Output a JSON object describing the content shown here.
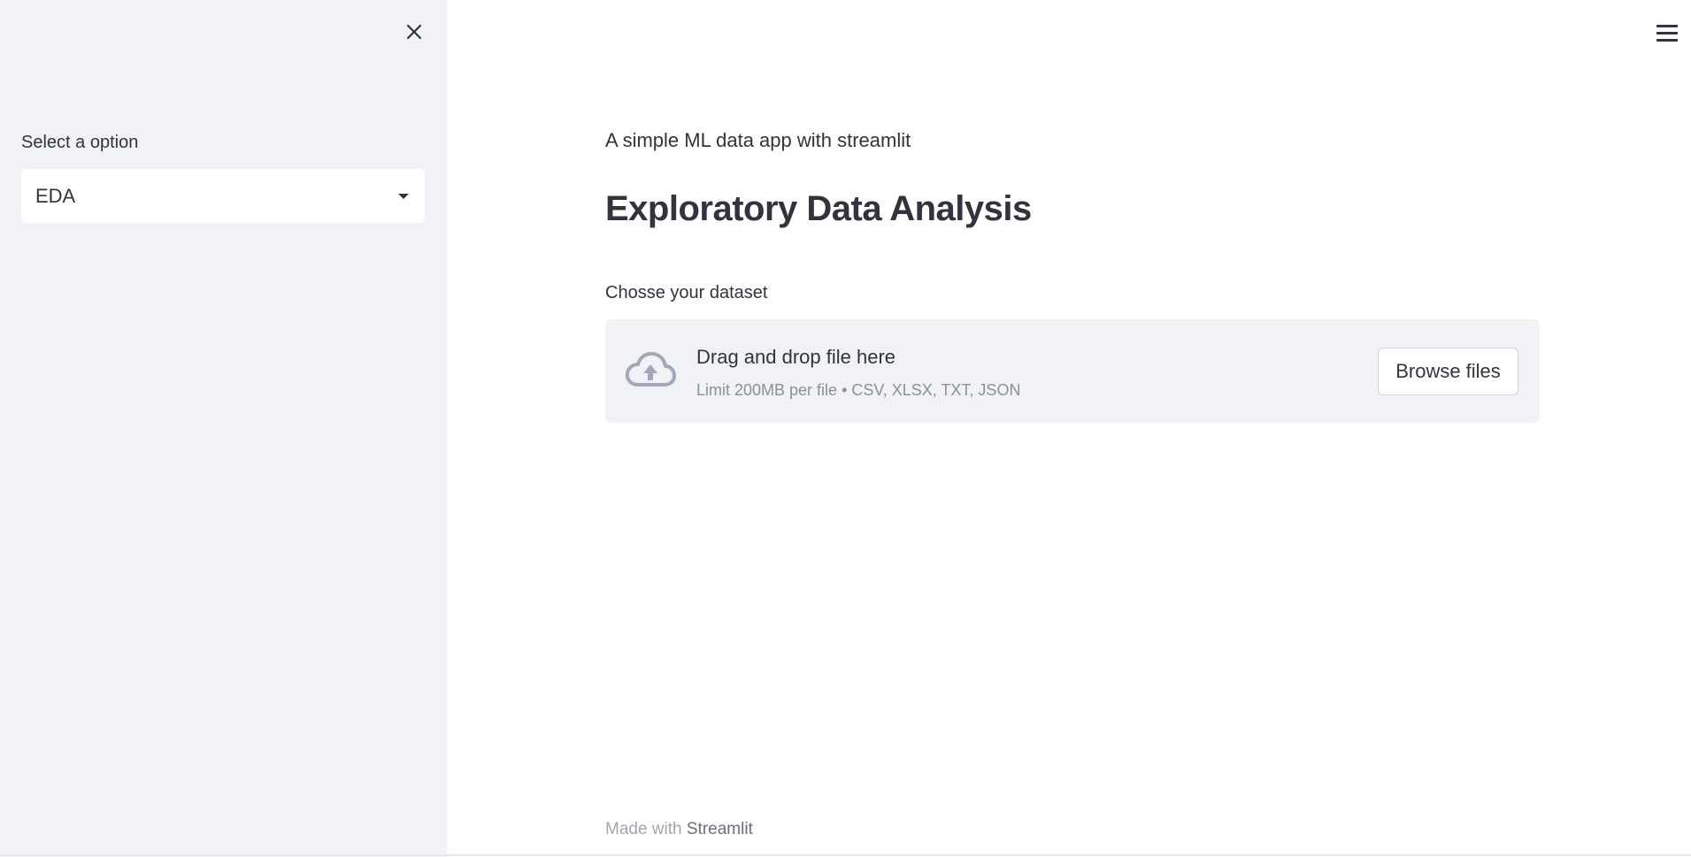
{
  "sidebar": {
    "select_label": "Select a option",
    "select_value": "EDA"
  },
  "main": {
    "subtitle": "A simple ML data app with streamlit",
    "title": "Exploratory Data Analysis",
    "uploader": {
      "label": "Chosse your dataset",
      "drop_text": "Drag and drop file here",
      "limit_text": "Limit 200MB per file • CSV, XLSX, TXT, JSON",
      "browse_label": "Browse files"
    }
  },
  "footer": {
    "prefix": "Made with",
    "brand": "Streamlit"
  },
  "icons": {
    "close": "close-icon",
    "menu": "hamburger-menu-icon",
    "dropdown": "chevron-down-icon",
    "upload": "cloud-upload-icon"
  },
  "colors": {
    "sidebar_bg": "#f0f2f6",
    "text": "#31333f",
    "muted": "#8c8f99",
    "icon_gray": "#a3a8b8"
  }
}
